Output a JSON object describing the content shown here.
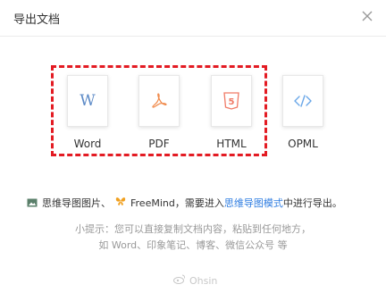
{
  "dialog": {
    "title": "导出文档",
    "close_icon": "close-icon"
  },
  "formats": [
    {
      "id": "word",
      "label": "Word",
      "icon": "word-icon",
      "icon_text": "W",
      "color": "#5b89c6"
    },
    {
      "id": "pdf",
      "label": "PDF",
      "icon": "pdf-icon",
      "color": "#f08a4b"
    },
    {
      "id": "html",
      "label": "HTML",
      "icon": "html5-icon",
      "icon_text": "5",
      "color": "#f07a66"
    },
    {
      "id": "opml",
      "label": "OPML",
      "icon": "code-icon",
      "color": "#6aa7e8"
    }
  ],
  "highlight": {
    "color": "#e31b23"
  },
  "mindmap": {
    "part1": "思维导图图片、",
    "part2": "FreeMind，需要进入",
    "link": "思维导图模式",
    "part3": "中进行导出。"
  },
  "tips": {
    "line1": "小提示：您可以直接复制文档内容，粘贴到任何地方，",
    "line2": "如 Word、印象笔记、博客、微信公众号 等"
  },
  "watermark": {
    "text": "Ohsin"
  }
}
